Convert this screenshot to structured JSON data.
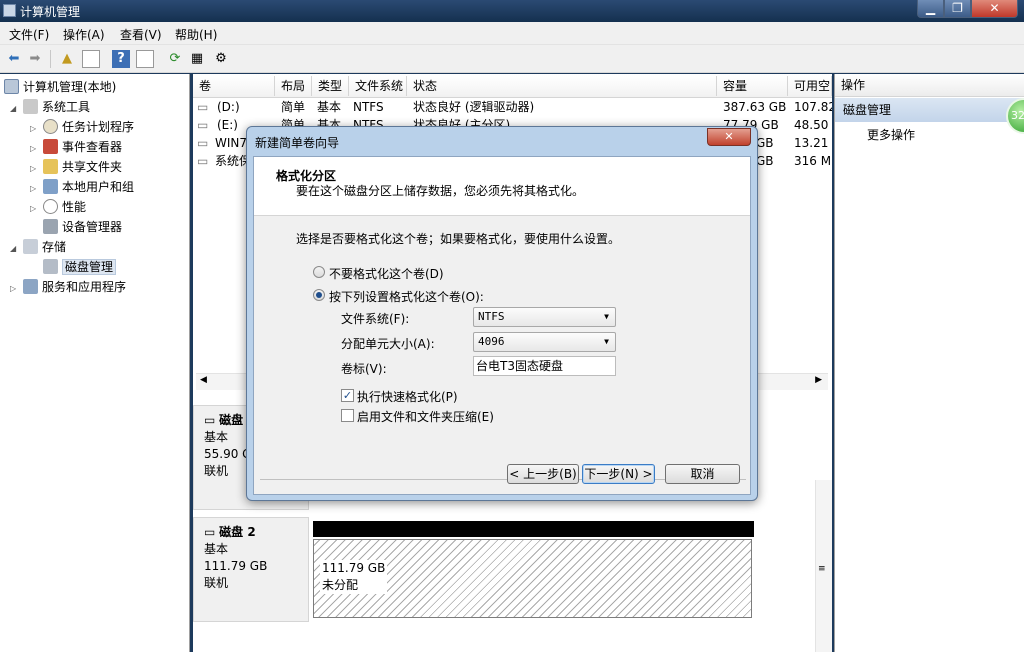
{
  "window": {
    "title": "计算机管理"
  },
  "menubar": {
    "items": [
      "文件(F)",
      "操作(A)",
      "查看(V)",
      "帮助(H)"
    ]
  },
  "tree": {
    "root": "计算机管理(本地)",
    "system_tools": "系统工具",
    "task_scheduler": "任务计划程序",
    "event_viewer": "事件查看器",
    "shared_folders": "共享文件夹",
    "local_users": "本地用户和组",
    "performance": "性能",
    "device_manager": "设备管理器",
    "storage": "存储",
    "disk_management": "磁盘管理",
    "services_apps": "服务和应用程序"
  },
  "volume_table": {
    "headers": [
      "卷",
      "布局",
      "类型",
      "文件系统",
      "状态",
      "容量",
      "可用空"
    ],
    "rows": [
      [
        "(D:)",
        "简单",
        "基本",
        "NTFS",
        "状态良好 (逻辑驱动器)",
        "387.63 GB",
        "107.82"
      ],
      [
        "(E:)",
        "简单",
        "基本",
        "NTFS",
        "状态良好 (主分区)",
        "77.79 GB",
        "48.50"
      ],
      [
        "WIN7",
        "",
        "",
        "",
        "",
        "GB",
        "13.21"
      ],
      [
        "系统保",
        "",
        "",
        "",
        "",
        "GB",
        "316 M"
      ]
    ]
  },
  "disks": {
    "disk1": {
      "name": "磁盘",
      "type": "基本",
      "size": "55.90 G",
      "status": "联机"
    },
    "disk2": {
      "name": "磁盘 2",
      "type": "基本",
      "size": "111.79 GB",
      "status": "联机",
      "part_size": "111.79 GB",
      "part_status": "未分配"
    }
  },
  "actions": {
    "header": "操作",
    "selected": "磁盘管理",
    "more": "更多操作",
    "orb_text": "32"
  },
  "dialog": {
    "title": "新建简单卷向导",
    "close": "✕",
    "heading": "格式化分区",
    "subheading": "要在这个磁盘分区上储存数据，您必须先将其格式化。",
    "prompt": "选择是否要格式化这个卷；如果要格式化，要使用什么设置。",
    "opt_no_format": "不要格式化这个卷(D)",
    "opt_format": "按下列设置格式化这个卷(O):",
    "fs_label": "文件系统(F):",
    "fs_value": "NTFS",
    "alloc_label": "分配单元大小(A):",
    "alloc_value": "4096",
    "vol_label": "卷标(V):",
    "vol_value": "台电T3固态硬盘",
    "quick_format": "执行快速格式化(P)",
    "compression": "启用文件和文件夹压缩(E)",
    "back": "< 上一步(B)",
    "next": "下一步(N) >",
    "cancel": "取消",
    "selected_option": "format",
    "quick_format_checked": true,
    "compression_checked": false
  },
  "colors": {
    "accent": "#3b7cc5",
    "title_bar": "#1d3a5c",
    "selection": "#dde6f1"
  }
}
